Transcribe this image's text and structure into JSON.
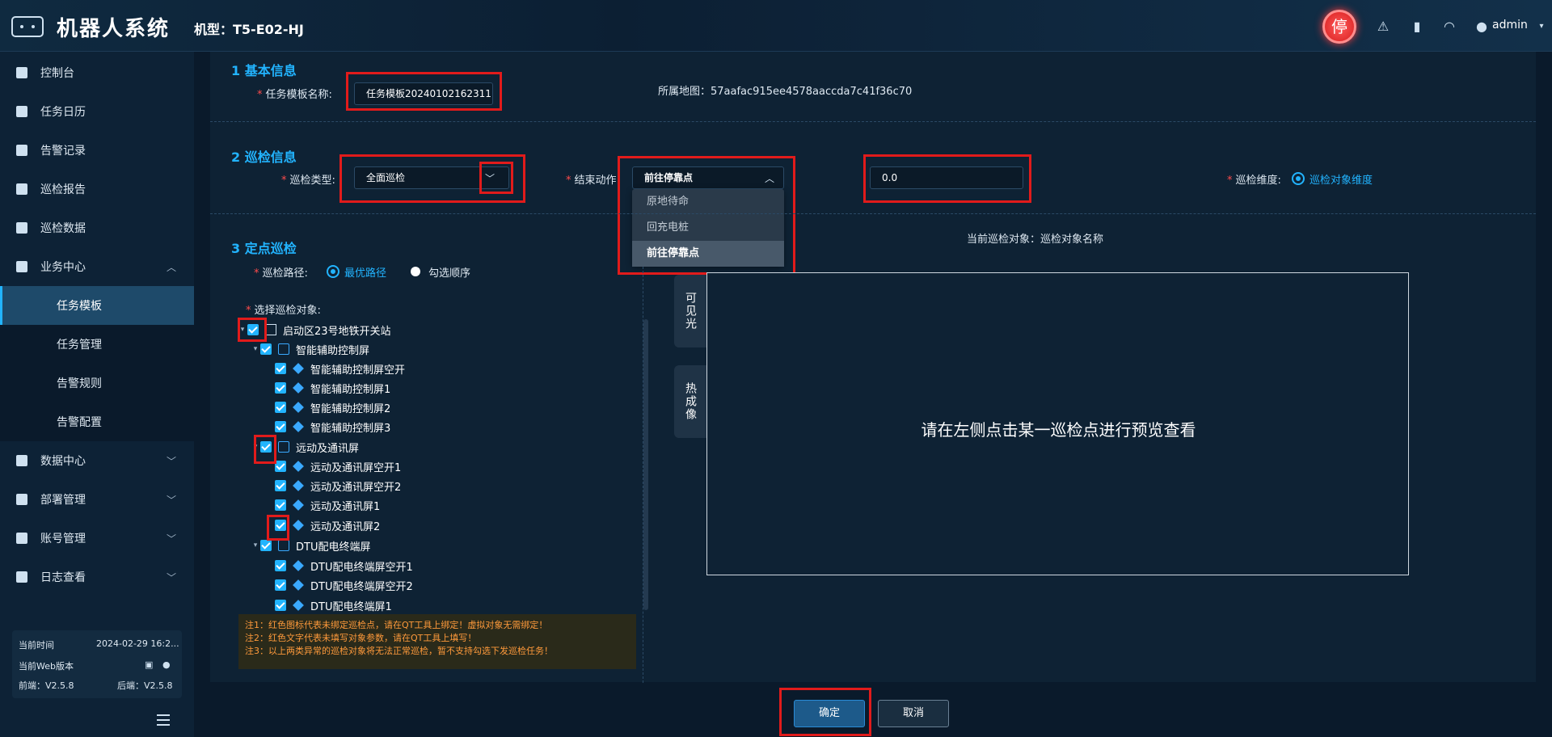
{
  "header": {
    "app_title": "机器人系统",
    "model_label": "机型：T5-E02-HJ",
    "stop_button": "停",
    "user": "admin"
  },
  "sidebar": {
    "items": [
      {
        "label": "控制台"
      },
      {
        "label": "任务日历"
      },
      {
        "label": "告警记录"
      },
      {
        "label": "巡检报告"
      },
      {
        "label": "巡检数据"
      },
      {
        "label": "业务中心"
      },
      {
        "label": "数据中心"
      },
      {
        "label": "部署管理"
      },
      {
        "label": "账号管理"
      },
      {
        "label": "日志查看"
      }
    ],
    "sub_items": [
      {
        "label": "任务模板"
      },
      {
        "label": "任务管理"
      },
      {
        "label": "告警规则"
      },
      {
        "label": "告警配置"
      }
    ],
    "info": {
      "time_label": "当前时间",
      "time_value": "2024-02-29 16:2...",
      "web_label": "当前Web版本",
      "frontend": "前端：V2.5.8",
      "backend": "后端：V2.5.8"
    }
  },
  "section1": {
    "title": "1 基本信息",
    "name_label": "任务模板名称:",
    "name_value": "任务模板20240102162311",
    "map_label": "所属地图：57aafac915ee4578aaccda7c41f36c70"
  },
  "section2": {
    "title": "2 巡检信息",
    "type_label": "巡检类型:",
    "type_value": "全面巡检",
    "end_label": "结束动作:",
    "end_value": "前往停靠点",
    "end_options": [
      "原地待命",
      "回充电桩",
      "前往停靠点"
    ],
    "num_value": "0.0",
    "dim_label": "巡检维度:",
    "dim_value": "巡检对象维度"
  },
  "section3": {
    "title": "3 定点巡检",
    "path_label": "巡检路径:",
    "path_opt1": "最优路径",
    "path_opt2": "勾选顺序",
    "select_label": "选择巡检对象:",
    "current_label": "当前巡检对象：巡检对象名称",
    "tab_visible": "可见光",
    "tab_thermal": "热成像",
    "preview_text": "请在左侧点击某一巡检点进行预览查看"
  },
  "tree": [
    {
      "label": "启动区23号地铁开关站"
    },
    {
      "label": "智能辅助控制屏"
    },
    {
      "label": "智能辅助控制屏空开"
    },
    {
      "label": "智能辅助控制屏1"
    },
    {
      "label": "智能辅助控制屏2"
    },
    {
      "label": "智能辅助控制屏3"
    },
    {
      "label": "远动及通讯屏"
    },
    {
      "label": "远动及通讯屏空开1"
    },
    {
      "label": "远动及通讯屏空开2"
    },
    {
      "label": "远动及通讯屏1"
    },
    {
      "label": "远动及通讯屏2"
    },
    {
      "label": "DTU配电终端屏"
    },
    {
      "label": "DTU配电终端屏空开1"
    },
    {
      "label": "DTU配电终端屏空开2"
    },
    {
      "label": "DTU配电终端屏1"
    }
  ],
  "notes": [
    "注1：红色图标代表未绑定巡检点，请在QT工具上绑定！虚拟对象无需绑定！",
    "注2：红色文字代表未填写对象参数，请在QT工具上填写！",
    "注3：以上两类异常的巡检对象将无法正常巡检，暂不支持勾选下发巡检任务！"
  ],
  "footer": {
    "confirm": "确定",
    "cancel": "取消"
  }
}
